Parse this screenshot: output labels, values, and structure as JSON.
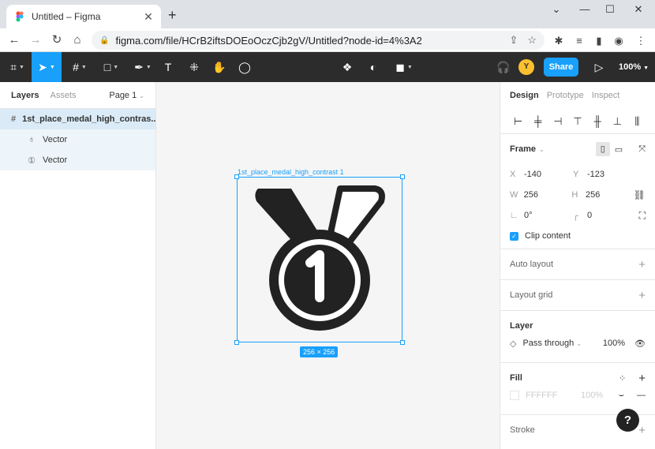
{
  "browser": {
    "tab_title": "Untitled – Figma",
    "url": "figma.com/file/HCrB2iftsDOEoOczCjb2gV/Untitled?node-id=4%3A2"
  },
  "toolbar": {
    "share_label": "Share",
    "avatar_initial": "Y",
    "zoom": "100%"
  },
  "left_panel": {
    "tabs": [
      "Layers",
      "Assets"
    ],
    "page": "Page 1",
    "layers": [
      {
        "name": "1st_place_medal_high_contrast 1",
        "display": "1st_place_medal_high_contras..."
      },
      {
        "name": "Vector"
      },
      {
        "name": "Vector"
      }
    ]
  },
  "canvas": {
    "frame_label": "1st_place_medal_high_contrast 1",
    "size_badge": "256 × 256",
    "medal_color": "#222222"
  },
  "right_panel": {
    "tabs": [
      "Design",
      "Prototype",
      "Inspect"
    ],
    "frame": {
      "title": "Frame",
      "x_label": "X",
      "x": "-140",
      "y_label": "Y",
      "y": "-123",
      "w_label": "W",
      "w": "256",
      "h_label": "H",
      "h": "256",
      "rotation": "0°",
      "radius": "0",
      "clip_content": "Clip content"
    },
    "auto_layout": "Auto layout",
    "layout_grid": "Layout grid",
    "layer": {
      "title": "Layer",
      "blend": "Pass through",
      "opacity": "100%"
    },
    "fill": {
      "title": "Fill",
      "hex": "FFFFFF",
      "opacity": "100%"
    },
    "stroke": "Stroke"
  },
  "colors": {
    "accent": "#18a0fb",
    "toolbar_bg": "#2c2c2c"
  }
}
